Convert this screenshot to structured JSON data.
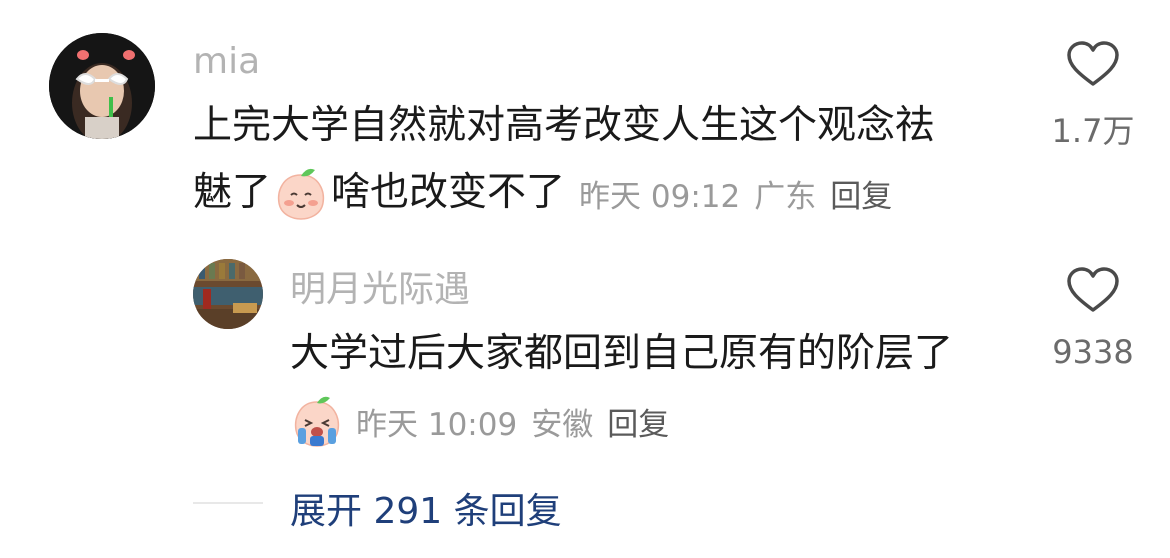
{
  "comment": {
    "username": "mia",
    "text_line1": "上完大学自然就对高考改变人生这个观念祛",
    "text_line2_before": "魅了",
    "text_line2_after": "啥也改变不了",
    "time": "昨天 09:12",
    "location": "广东",
    "reply_label": "回复",
    "like_count": "1.7万"
  },
  "reply": {
    "username": "明月光际遇",
    "text": "大学过后大家都回到自己原有的阶层了",
    "time": "昨天 10:09",
    "location": "安徽",
    "reply_label": "回复",
    "like_count": "9338"
  },
  "expand": {
    "label": "展开 291 条回复"
  },
  "icons": {
    "heart": "heart-outline-icon",
    "emoji_1": "smiling-peach-emoji-icon",
    "emoji_2": "crying-peach-emoji-icon"
  },
  "colors": {
    "username": "#b3b3b3",
    "text": "#1a1a1a",
    "meta": "#9a9a9a",
    "expand_link": "#1f3f7a"
  }
}
